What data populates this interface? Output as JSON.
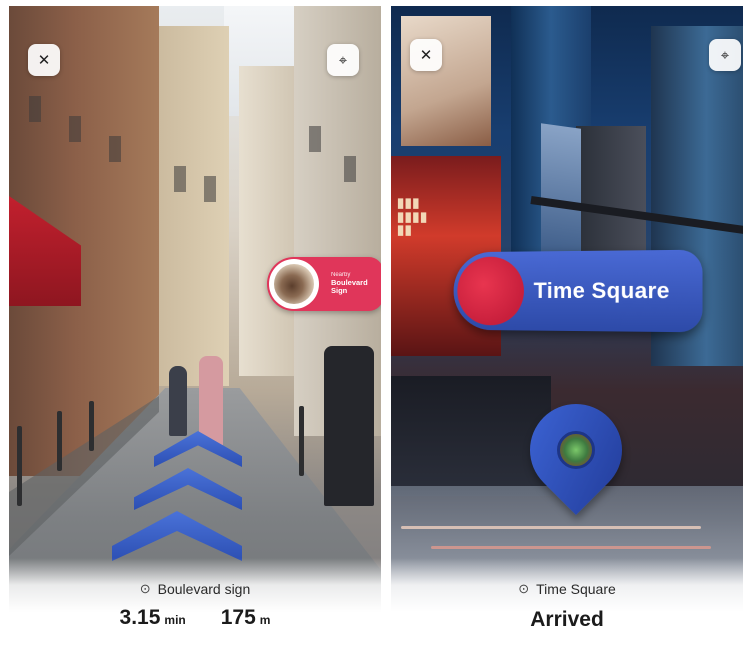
{
  "left_screen": {
    "nearby_card": {
      "kicker": "Nearby",
      "title": "Boulevard Sign"
    },
    "destination": "Boulevard sign",
    "stats": [
      {
        "value": "3.15",
        "unit": "min"
      },
      {
        "value": "175",
        "unit": "m"
      }
    ],
    "icons": {
      "close": "close-icon",
      "locate": "locate-icon",
      "pin": "location-pin-icon"
    }
  },
  "right_screen": {
    "ar_label": "Time Square",
    "destination": "Time Square",
    "status": "Arrived",
    "icons": {
      "close": "close-icon",
      "locate": "locate-icon",
      "pin": "location-pin-icon"
    }
  },
  "colors": {
    "accent_blue": "#3456c4",
    "accent_red": "#e0365a",
    "panel_text": "#1b1b1b"
  }
}
